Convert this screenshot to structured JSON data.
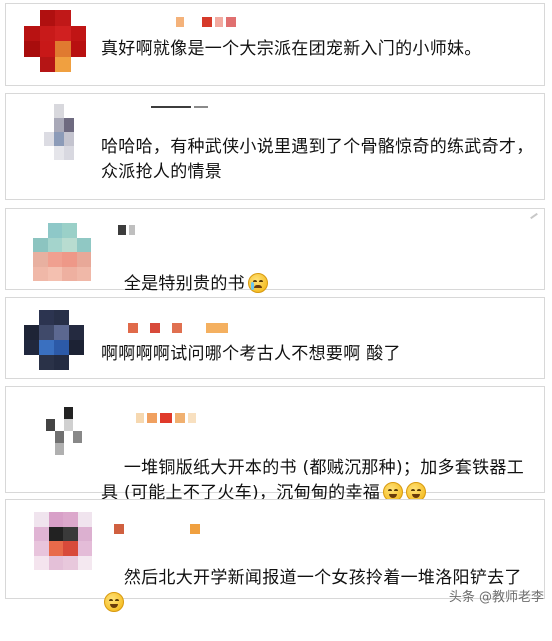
{
  "comments": [
    {
      "text": "真好啊就像是一个大宗派在团宠新入门的小师妹。",
      "emoji": []
    },
    {
      "text": "哈哈哈，有种武侠小说里遇到了个骨骼惊奇的练武奇才，众派抢人的情景",
      "emoji": []
    },
    {
      "text": "全是特别贵的书",
      "emoji": [
        "crying-face-icon"
      ]
    },
    {
      "text": "啊啊啊啊试问哪个考古人不想要啊 酸了",
      "emoji": []
    },
    {
      "text": "一堆铜版纸大开本的书 (都贼沉那种)；加多套铁器工具 (可能上不了火车)，沉甸甸的幸福",
      "emoji": [
        "laughing-tears-face-icon",
        "smiling-face-icon"
      ]
    },
    {
      "text": "然后北大开学新闻报道一个女孩拎着一堆洛阳铲去了",
      "emoji": [
        "laughing-tears-face-icon"
      ]
    }
  ],
  "watermark": "头条 @教师老李",
  "colors": {
    "card_border": "#d8d8d8",
    "background": "#ffffff",
    "text": "#111111"
  }
}
